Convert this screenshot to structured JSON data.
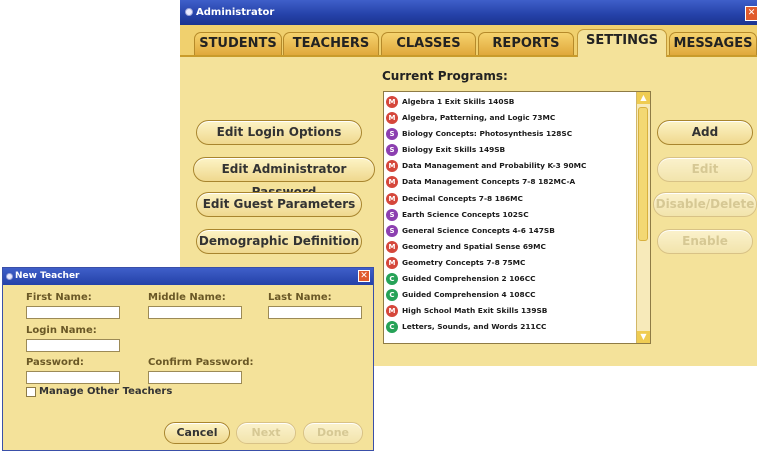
{
  "admin": {
    "title": "Administrator",
    "close_glyph": "✕",
    "tabs": [
      "STUDENTS",
      "TEACHERS",
      "CLASSES",
      "REPORTS",
      "SETTINGS",
      "MESSAGES"
    ],
    "active_tab": "SETTINGS",
    "programs_label": "Current Programs:",
    "left_buttons": [
      "Edit Login Options",
      "Edit Administrator Password",
      "Edit Guest Parameters",
      "Demographic Definition"
    ],
    "right_buttons": [
      "Add",
      "Edit",
      "Disable/Delete",
      "Enable"
    ],
    "right_buttons_disabled": [
      "Edit",
      "Disable/Delete",
      "Enable"
    ],
    "programs": [
      {
        "name": "Algebra 1 Exit Skills 140SB",
        "icon": "math-icon"
      },
      {
        "name": "Algebra, Patterning, and Logic 73MC",
        "icon": "math-icon"
      },
      {
        "name": "Biology Concepts: Photosynthesis 128SC",
        "icon": "science-icon"
      },
      {
        "name": "Biology Exit Skills 149SB",
        "icon": "science-icon"
      },
      {
        "name": "Data Management and Probability K-3 90MC",
        "icon": "math-icon"
      },
      {
        "name": "Data Management Concepts 7-8 182MC-A",
        "icon": "math-icon"
      },
      {
        "name": "Decimal Concepts 7-8 186MC",
        "icon": "math-icon"
      },
      {
        "name": "Earth Science Concepts 102SC",
        "icon": "science-icon"
      },
      {
        "name": "General Science Concepts 4-6 147SB",
        "icon": "science-icon"
      },
      {
        "name": "Geometry and Spatial Sense 69MC",
        "icon": "math-icon"
      },
      {
        "name": "Geometry Concepts 7-8 75MC",
        "icon": "math-icon"
      },
      {
        "name": "Guided Comprehension 2 106CC",
        "icon": "comprehension-icon"
      },
      {
        "name": "Guided Comprehension 4 108CC",
        "icon": "comprehension-icon"
      },
      {
        "name": "High School Math Exit Skills 139SB",
        "icon": "math-icon"
      },
      {
        "name": "Letters, Sounds, and Words 211CC",
        "icon": "comprehension-icon"
      }
    ],
    "icon_colors": {
      "math-icon": "#d5473b",
      "science-icon": "#8c3fb0",
      "comprehension-icon": "#26a257"
    }
  },
  "new_teacher": {
    "title": "New Teacher",
    "close_glyph": "✕",
    "first_name_label": "First Name:",
    "middle_name_label": "Middle Name:",
    "last_name_label": "Last Name:",
    "login_name_label": "Login Name:",
    "password_label": "Password:",
    "confirm_password_label": "Confirm Password:",
    "first_name_value": "",
    "middle_name_value": "",
    "last_name_value": "",
    "login_name_value": "",
    "password_value": "",
    "confirm_password_value": "",
    "manage_label": "Manage Other Teachers",
    "manage_checked": false,
    "cancel_label": "Cancel",
    "next_label": "Next",
    "done_label": "Done",
    "next_disabled": true,
    "done_disabled": true
  }
}
